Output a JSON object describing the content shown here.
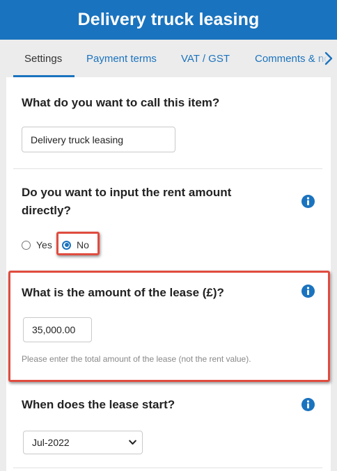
{
  "header": {
    "title": "Delivery truck leasing"
  },
  "tabs": [
    {
      "label": "Settings",
      "active": true
    },
    {
      "label": "Payment terms",
      "active": false
    },
    {
      "label": "VAT / GST",
      "active": false
    },
    {
      "label": "Comments & notes",
      "active": false
    }
  ],
  "item_name": {
    "question": "What do you want to call this item?",
    "value": "Delivery truck leasing"
  },
  "rent_input": {
    "question_line1": "Do you want to input the rent amount",
    "question_line2": "directly?",
    "options": [
      {
        "label": "Yes",
        "checked": false
      },
      {
        "label": "No",
        "checked": true
      }
    ]
  },
  "lease_amount": {
    "question": "What is the amount of the lease (£)?",
    "value": "35,000.00",
    "help": "Please enter the total amount of the lease (not the rent value)."
  },
  "lease_start": {
    "question": "When does the lease start?",
    "selected": "Jul-2022"
  },
  "colors": {
    "brand": "#1a73be",
    "highlight": "#e04c3f"
  },
  "icons": {
    "info": "info-circle-icon",
    "tab_next": "chevron-right-icon",
    "select_caret": "chevron-down-icon"
  }
}
